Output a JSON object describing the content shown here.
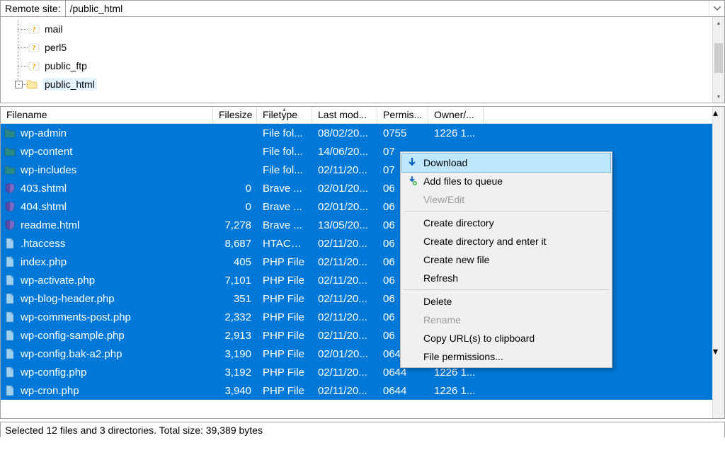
{
  "remote_label": "Remote site:",
  "remote_path": "/public_html",
  "tree": {
    "items": [
      {
        "name": "mail",
        "icon": "question"
      },
      {
        "name": "perl5",
        "icon": "question"
      },
      {
        "name": "public_ftp",
        "icon": "question"
      },
      {
        "name": "public_html",
        "icon": "folder",
        "expander": "-",
        "selected": true
      }
    ]
  },
  "columns": {
    "filename": "Filename",
    "filesize": "Filesize",
    "filetype": "Filetype",
    "lastmod": "Last mod...",
    "perm": "Permis...",
    "owner": "Owner/..."
  },
  "files": [
    {
      "icon": "folder-teal",
      "name": "wp-admin",
      "size": "",
      "type": "File fol...",
      "mod": "08/02/20...",
      "perm": "0755",
      "owner": "1226 1..."
    },
    {
      "icon": "folder-teal",
      "name": "wp-content",
      "size": "",
      "type": "File fol...",
      "mod": "14/06/20...",
      "perm": "07",
      "owner": ""
    },
    {
      "icon": "folder-teal",
      "name": "wp-includes",
      "size": "",
      "type": "File fol...",
      "mod": "02/11/20...",
      "perm": "07",
      "owner": ""
    },
    {
      "icon": "shield",
      "name": "403.shtml",
      "size": "0",
      "type": "Brave ...",
      "mod": "02/01/20...",
      "perm": "06",
      "owner": ""
    },
    {
      "icon": "shield",
      "name": "404.shtml",
      "size": "0",
      "type": "Brave ...",
      "mod": "02/01/20...",
      "perm": "06",
      "owner": ""
    },
    {
      "icon": "shield",
      "name": "readme.html",
      "size": "7,278",
      "type": "Brave ...",
      "mod": "13/05/20...",
      "perm": "06",
      "owner": ""
    },
    {
      "icon": "file",
      "name": ".htaccess",
      "size": "8,687",
      "type": "HTACC...",
      "mod": "02/11/20...",
      "perm": "06",
      "owner": ""
    },
    {
      "icon": "file",
      "name": "index.php",
      "size": "405",
      "type": "PHP File",
      "mod": "02/11/20...",
      "perm": "06",
      "owner": ""
    },
    {
      "icon": "file",
      "name": "wp-activate.php",
      "size": "7,101",
      "type": "PHP File",
      "mod": "02/11/20...",
      "perm": "06",
      "owner": ""
    },
    {
      "icon": "file",
      "name": "wp-blog-header.php",
      "size": "351",
      "type": "PHP File",
      "mod": "02/11/20...",
      "perm": "06",
      "owner": ""
    },
    {
      "icon": "file",
      "name": "wp-comments-post.php",
      "size": "2,332",
      "type": "PHP File",
      "mod": "02/11/20...",
      "perm": "06",
      "owner": ""
    },
    {
      "icon": "file",
      "name": "wp-config-sample.php",
      "size": "2,913",
      "type": "PHP File",
      "mod": "02/11/20...",
      "perm": "06",
      "owner": ""
    },
    {
      "icon": "file",
      "name": "wp-config.bak-a2.php",
      "size": "3,190",
      "type": "PHP File",
      "mod": "02/01/20...",
      "perm": "0644",
      "owner": "1226 1..."
    },
    {
      "icon": "file",
      "name": "wp-config.php",
      "size": "3,192",
      "type": "PHP File",
      "mod": "02/11/20...",
      "perm": "0644",
      "owner": "1226 1..."
    },
    {
      "icon": "file",
      "name": "wp-cron.php",
      "size": "3,940",
      "type": "PHP File",
      "mod": "02/11/20...",
      "perm": "0644",
      "owner": "1226 1..."
    }
  ],
  "context_menu": {
    "download": "Download",
    "add_to_queue": "Add files to queue",
    "view_edit": "View/Edit",
    "create_dir": "Create directory",
    "create_dir_enter": "Create directory and enter it",
    "create_file": "Create new file",
    "refresh": "Refresh",
    "delete": "Delete",
    "rename": "Rename",
    "copy_urls": "Copy URL(s) to clipboard",
    "file_perms": "File permissions..."
  },
  "status": "Selected 12 files and 3 directories. Total size: 39,389 bytes"
}
